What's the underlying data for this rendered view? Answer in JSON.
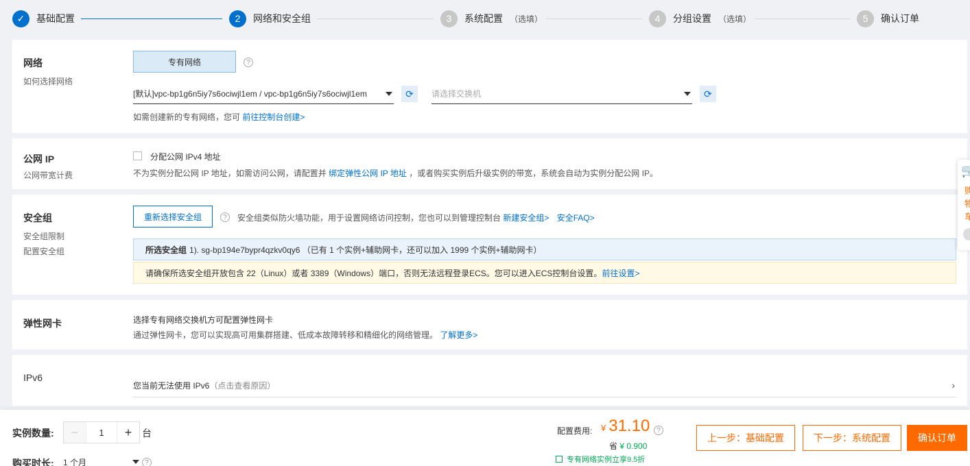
{
  "steps": [
    {
      "num": "✓",
      "label": "基础配置",
      "optional": ""
    },
    {
      "num": "2",
      "label": "网络和安全组",
      "optional": ""
    },
    {
      "num": "3",
      "label": "系统配置",
      "optional": "（选填）"
    },
    {
      "num": "4",
      "label": "分组设置",
      "optional": "（选填）"
    },
    {
      "num": "5",
      "label": "确认订单",
      "optional": ""
    }
  ],
  "network": {
    "title": "网络",
    "sub": "如何选择网络",
    "vpc_button": "专有网络",
    "help": "?",
    "vpc_select": "[默认]vpc-bp1g6n5iy7s6ociwjl1em / vpc-bp1g6n5iy7s6ociwjl1em",
    "switch_placeholder": "请选择交换机",
    "hint": "如需创建新的专有网络，您可",
    "hint_link": "前往控制台创建>"
  },
  "public_ip": {
    "title": "公网 IP",
    "sub": "公网带宽计费",
    "checkbox_label": "分配公网 IPv4 地址",
    "desc_pre": "不为实例分配公网 IP 地址，如需访问公网，请配置并",
    "desc_link": "绑定弹性公网 IP 地址",
    "desc_post": "，或者购买实例后升级实例的带宽，系统会自动为实例分配公网 IP。"
  },
  "security_group": {
    "title": "安全组",
    "sub1": "安全组限制",
    "sub2": "配置安全组",
    "reselect_button": "重新选择安全组",
    "help": "?",
    "desc": "安全组类似防火墙功能，用于设置网络访问控制，您也可以到管理控制台",
    "link_new": "新建安全组>",
    "link_faq": "安全FAQ>",
    "selected_label": "所选安全组",
    "selected_value": "1). sg-bp194e7bypr4qzkv0qy6 （已有 1 个实例+辅助网卡，还可以加入 1999 个实例+辅助网卡）",
    "warn_text": "请确保所选安全组开放包含 22（Linux）或者 3389（Windows）端口，否则无法远程登录ECS。您可以进入ECS控制台设置。",
    "warn_link": "前往设置>"
  },
  "eni": {
    "title": "弹性网卡",
    "line1": "选择专有网络交换机方可配置弹性网卡",
    "line2": "通过弹性网卡，您可以实现高可用集群搭建、低成本故障转移和精细化的网络管理。",
    "link": "了解更多>"
  },
  "ipv6": {
    "title": "IPv6",
    "text": "您当前无法使用 IPv6",
    "hint": "（点击查看原因）",
    "chevron": "›"
  },
  "float_cart": {
    "text": "购物车"
  },
  "bottom": {
    "qty_label": "实例数量:",
    "qty_minus": "−",
    "qty_value": "1",
    "qty_plus": "+",
    "qty_unit": "台",
    "duration_label": "购买时长:",
    "duration_value": "1 个月",
    "fee_label": "配置费用:",
    "currency": "¥",
    "price": "31.10",
    "help": "?",
    "save_label": "省",
    "save_value": "¥ 0.900",
    "promo": "专有网络实例立享9.5折",
    "prev_button": "上一步：基础配置",
    "next_button": "下一步：系统配置",
    "confirm_button": "确认订单"
  },
  "colors": {
    "accent": "#0070cc",
    "orange": "#ff6a00",
    "green": "#00a854"
  }
}
